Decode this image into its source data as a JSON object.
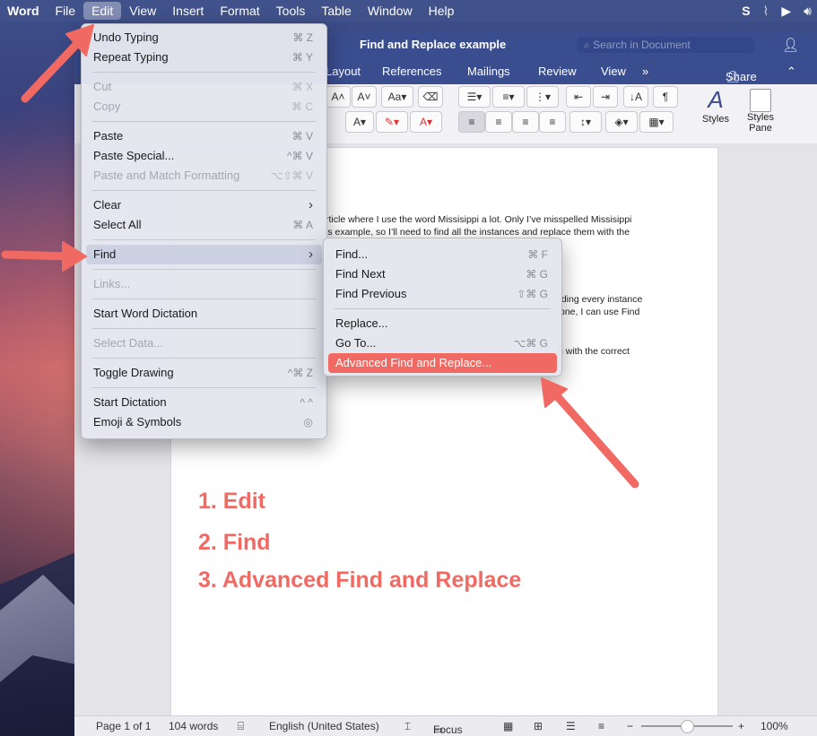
{
  "menubar": {
    "app": "Word",
    "items": [
      "File",
      "Edit",
      "View",
      "Insert",
      "Format",
      "Tools",
      "Table",
      "Window",
      "Help"
    ]
  },
  "window": {
    "title": "Find and Replace example",
    "search_placeholder": "Search in Document",
    "tabs": [
      "Layout",
      "References",
      "Mailings",
      "Review",
      "View"
    ],
    "share": "Share",
    "styles_label": "Styles",
    "styles_pane_label": "Styles Pane"
  },
  "document": {
    "lines": [
      "rticle where I use the word Missisippi a lot. Only I’ve misspelled Missisippi",
      "is example, so I’ll need to find all the instances and replace them with the",
      "nding every instance",
      "one, I can use Find",
      "h with the correct"
    ],
    "steps": [
      "1. Edit",
      "2. Find",
      "3. Advanced Find and Replace"
    ]
  },
  "edit_menu": {
    "items": [
      {
        "label": "Undo Typing",
        "shortcut": "⌘ Z",
        "disabled": false
      },
      {
        "label": "Repeat Typing",
        "shortcut": "⌘ Y",
        "disabled": false
      },
      {
        "label": "Cut",
        "shortcut": "⌘ X",
        "disabled": true
      },
      {
        "label": "Copy",
        "shortcut": "⌘ C",
        "disabled": true
      },
      {
        "label": "Paste",
        "shortcut": "⌘ V",
        "disabled": false
      },
      {
        "label": "Paste Special...",
        "shortcut": "^⌘ V",
        "disabled": false
      },
      {
        "label": "Paste and Match Formatting",
        "shortcut": "⌥⇧⌘ V",
        "disabled": true
      },
      {
        "label": "Clear",
        "shortcut": "›",
        "disabled": false
      },
      {
        "label": "Select All",
        "shortcut": "⌘ A",
        "disabled": false
      },
      {
        "label": "Find",
        "shortcut": "›",
        "disabled": false
      },
      {
        "label": "Links...",
        "shortcut": "",
        "disabled": true
      },
      {
        "label": "Start Word Dictation",
        "shortcut": "",
        "disabled": false
      },
      {
        "label": "Select Data...",
        "shortcut": "",
        "disabled": true
      },
      {
        "label": "Toggle Drawing",
        "shortcut": "^⌘ Z",
        "disabled": false
      },
      {
        "label": "Start Dictation",
        "shortcut": "^ ^",
        "disabled": false
      },
      {
        "label": "Emoji & Symbols",
        "shortcut": "◎",
        "disabled": false
      }
    ]
  },
  "find_submenu": {
    "items": [
      {
        "label": "Find...",
        "shortcut": "⌘ F"
      },
      {
        "label": "Find Next",
        "shortcut": "⌘ G"
      },
      {
        "label": "Find Previous",
        "shortcut": "⇧⌘ G"
      },
      {
        "label": "Replace...",
        "shortcut": ""
      },
      {
        "label": "Go To...",
        "shortcut": "⌥⌘ G"
      },
      {
        "label": "Advanced Find and Replace...",
        "shortcut": ""
      }
    ]
  },
  "statusbar": {
    "page": "Page 1 of 1",
    "words": "104 words",
    "language": "English (United States)",
    "focus": "Focus",
    "zoom": "100%"
  },
  "colors": {
    "accent": "#3a4d8f",
    "annotation": "#f06a63"
  }
}
